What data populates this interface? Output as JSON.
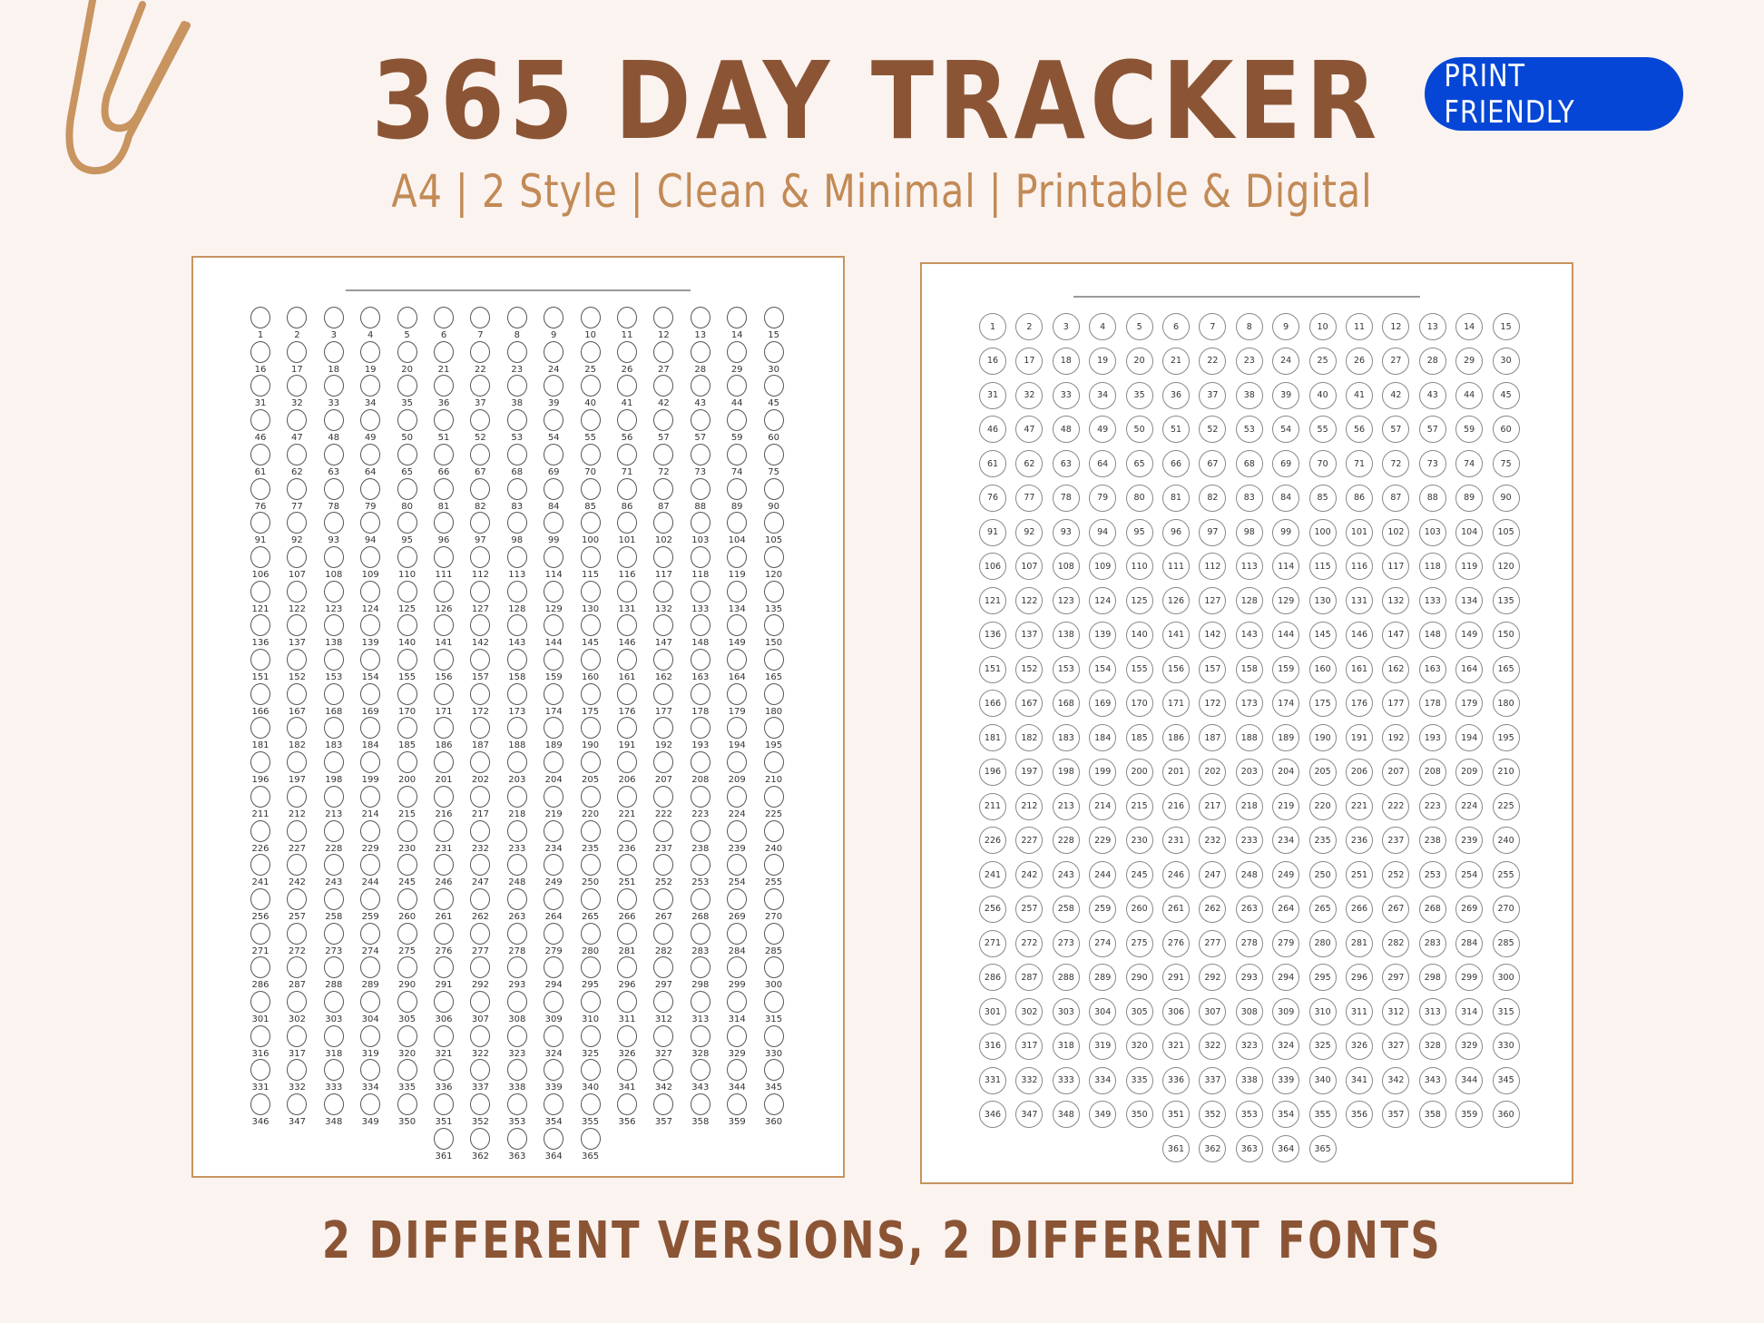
{
  "header": {
    "title": "365 DAY TRACKER",
    "subtitle": "A4 | 2 Style | Clean & Minimal | Printable & Digital",
    "badge": "PRINT FRIENDLY"
  },
  "footer": {
    "text": "2 DIFFERENT VERSIONS, 2 DIFFERENT FONTS"
  },
  "colors": {
    "background": "#FBF3F0",
    "title": "#8B5535",
    "subtitle": "#C28A55",
    "badge": "#0546D6",
    "page_border": "#C8935F",
    "paperclip": "#C8945F"
  },
  "trackers": [
    {
      "name": "style-1",
      "style": "circle-above-number",
      "columns": 15,
      "total_days": 365,
      "labels_override": {
        "58": "57"
      }
    },
    {
      "name": "style-2",
      "style": "number-inside-circle",
      "columns": 15,
      "total_days": 365,
      "labels_override": {
        "58": "57"
      }
    }
  ]
}
